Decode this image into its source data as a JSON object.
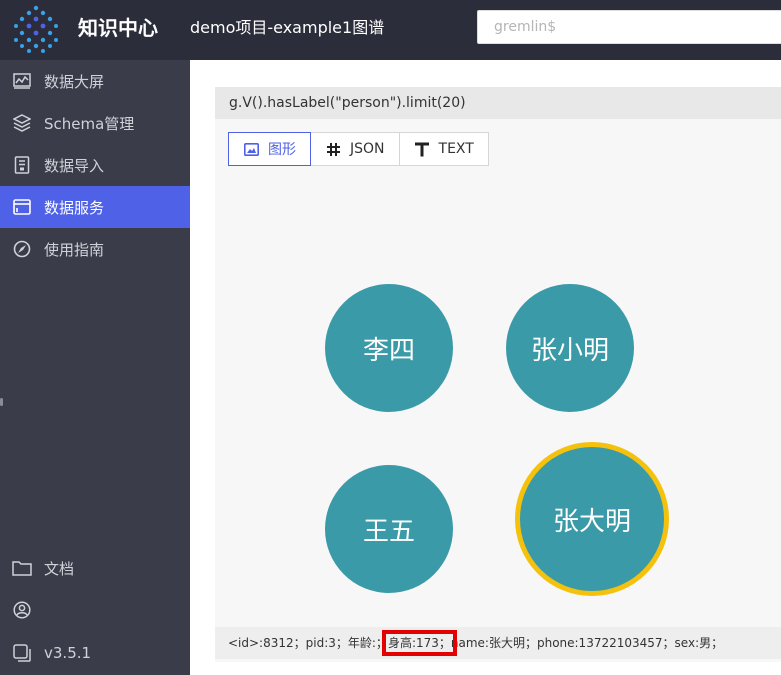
{
  "header": {
    "brand": "知识中心",
    "project": "demo项目-example1图谱",
    "search_placeholder": "gremlin$"
  },
  "sidebar": {
    "items": [
      {
        "label": "数据大屏",
        "icon": "chart-line-icon"
      },
      {
        "label": "Schema管理",
        "icon": "layers-icon"
      },
      {
        "label": "数据导入",
        "icon": "import-icon"
      },
      {
        "label": "数据服务",
        "icon": "window-icon"
      },
      {
        "label": "使用指南",
        "icon": "compass-icon"
      }
    ],
    "active_index": 3,
    "bottom": {
      "docs_label": "文档",
      "version": "v3.5.1"
    }
  },
  "query": "g.V().hasLabel(\"person\").limit(20)",
  "tabs": [
    {
      "label": "图形",
      "icon": "image-icon"
    },
    {
      "label": "JSON",
      "icon": "hash-icon"
    },
    {
      "label": "TEXT",
      "icon": "text-icon"
    }
  ],
  "graph": {
    "nodes": [
      {
        "label": "李四",
        "selected": false
      },
      {
        "label": "张小明",
        "selected": false
      },
      {
        "label": "王五",
        "selected": false
      },
      {
        "label": "张大明",
        "selected": true
      }
    ]
  },
  "detail": {
    "before": "<id>:8312；pid:3；年龄:；",
    "highlight": "身高:173；",
    "after": "name:张大明；phone:13722103457；sex:男；"
  },
  "colors": {
    "topbar": "#2b2d3a",
    "sidebar": "#3a3c4a",
    "accent": "#4f61e6",
    "node": "#3b9aa8",
    "selected_ring": "#f4c10c",
    "highlight_box": "#e30000"
  }
}
